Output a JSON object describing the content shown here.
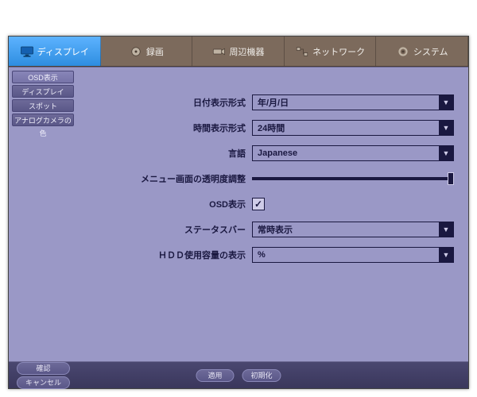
{
  "topnav": {
    "tabs": [
      {
        "label": "ディスプレイ",
        "active": true
      },
      {
        "label": "録画",
        "active": false
      },
      {
        "label": "周辺機器",
        "active": false
      },
      {
        "label": "ネットワーク",
        "active": false
      },
      {
        "label": "システム",
        "active": false
      }
    ]
  },
  "sidebar": {
    "items": [
      {
        "label": "OSD表示",
        "active": true
      },
      {
        "label": "ディスプレイ",
        "active": false
      },
      {
        "label": "スポット",
        "active": false
      },
      {
        "label": "アナログカメラの色",
        "active": false
      }
    ]
  },
  "settings": {
    "date_format": {
      "label": "日付表示形式",
      "value": "年/月/日"
    },
    "time_format": {
      "label": "時間表示形式",
      "value": "24時間"
    },
    "language": {
      "label": "言語",
      "value": "Japanese"
    },
    "transparency": {
      "label": "メニュー画面の透明度調整"
    },
    "osd": {
      "label": "OSD表示",
      "checked": true
    },
    "statusbar": {
      "label": "ステータスバー",
      "value": "常時表示"
    },
    "hdd": {
      "label": "ＨＤＤ使用容量の表示",
      "value": "%"
    }
  },
  "footer": {
    "confirm": "確認",
    "cancel": "キャンセル",
    "apply": "適用",
    "reset": "初期化"
  }
}
